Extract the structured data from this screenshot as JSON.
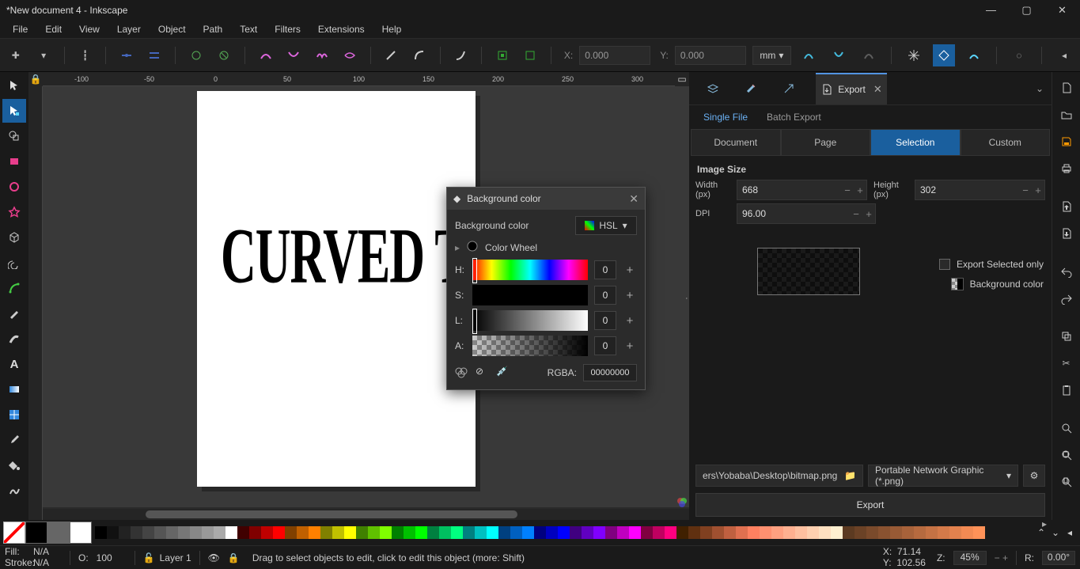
{
  "window": {
    "title": "*New document 4 - Inkscape"
  },
  "menu": [
    "File",
    "Edit",
    "View",
    "Layer",
    "Object",
    "Path",
    "Text",
    "Filters",
    "Extensions",
    "Help"
  ],
  "toolopts": {
    "x_label": "X:",
    "x_value": "0.000",
    "y_label": "Y:",
    "y_value": "0.000",
    "unit": "mm"
  },
  "canvas": {
    "art_text": "CURVED TEX",
    "ruler_ticks": [
      "-100",
      "-50",
      "0",
      "50",
      "100",
      "150",
      "200",
      "250",
      "300"
    ]
  },
  "dialog": {
    "title": "Background color",
    "label": "Background color",
    "mode": "HSL",
    "wheel_label": "Color Wheel",
    "h_label": "H:",
    "h_val": "0",
    "s_label": "S:",
    "s_val": "0",
    "l_label": "L:",
    "l_val": "0",
    "a_label": "A:",
    "a_val": "0",
    "rgba_label": "RGBA:",
    "rgba_val": "00000000"
  },
  "export": {
    "tab_label": "Export",
    "subtabs": {
      "single": "Single File",
      "batch": "Batch Export"
    },
    "scopes": [
      "Document",
      "Page",
      "Selection",
      "Custom"
    ],
    "section_image_size": "Image Size",
    "width_label": "Width (px)",
    "width_val": "668",
    "height_label": "Height (px)",
    "height_val": "302",
    "dpi_label": "DPI",
    "dpi_val": "96.00",
    "export_selected_only": "Export Selected only",
    "bg_color_label": "Background color",
    "path_value": "ers\\Yobaba\\Desktop\\bitmap.png",
    "format": "Portable Network Graphic (*.png)",
    "export_button": "Export"
  },
  "palette": {
    "big_swatches": [
      "cross",
      "#000",
      "#666",
      "#fff"
    ],
    "colors": [
      "#000",
      "#111",
      "#222",
      "#333",
      "#444",
      "#555",
      "#666",
      "#777",
      "#888",
      "#999",
      "#aaa",
      "#fff",
      "#400000",
      "#800000",
      "#c00000",
      "#ff0000",
      "#804000",
      "#c06000",
      "#ff8000",
      "#808000",
      "#c0c000",
      "#ffff00",
      "#408000",
      "#60c000",
      "#80ff00",
      "#008000",
      "#00c000",
      "#00ff00",
      "#008040",
      "#00c060",
      "#00ff80",
      "#008080",
      "#00c0c0",
      "#00ffff",
      "#004080",
      "#0060c0",
      "#0080ff",
      "#000080",
      "#0000c0",
      "#0000ff",
      "#400080",
      "#6000c0",
      "#8000ff",
      "#800080",
      "#c000c0",
      "#ff00ff",
      "#800040",
      "#c00060",
      "#ff0080",
      "#402000",
      "#603010",
      "#804020",
      "#a05030",
      "#c06040",
      "#e07050",
      "#ff8060",
      "#ff9070",
      "#ffa080",
      "#ffb090",
      "#ffc0a0",
      "#ffd0b0",
      "#ffe0c0",
      "#fff0d0",
      "#5c3a21",
      "#6b4226",
      "#7a4a2b",
      "#895230",
      "#985a35",
      "#a7623a",
      "#b66a3f",
      "#c57244",
      "#d47a49",
      "#e3824e",
      "#f28a53",
      "#ff9258"
    ]
  },
  "status": {
    "fill_label": "Fill:",
    "fill_val": "N/A",
    "stroke_label": "Stroke:",
    "stroke_val": "N/A",
    "opacity_label": "O:",
    "opacity_val": "100",
    "layer": "Layer 1",
    "hint": "Drag to select objects to edit, click to edit this object (more: Shift)",
    "x_label": "X:",
    "x_val": "71.14",
    "y_label": "Y:",
    "y_val": "102.56",
    "z_label": "Z:",
    "z_val": "45%",
    "r_label": "R:",
    "r_val": "0.00°"
  }
}
